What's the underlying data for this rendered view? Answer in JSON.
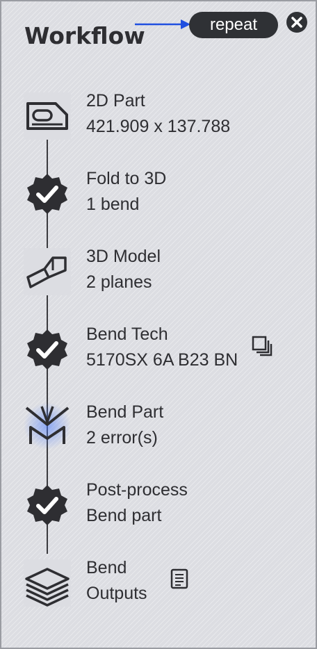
{
  "header": {
    "title": "Workflow",
    "repeat_label": "repeat"
  },
  "icons": {
    "close": "close-circle-icon",
    "arrow": "arrow-right-icon"
  },
  "colors": {
    "accent_arrow": "#1f4fe0",
    "dark": "#2f3135",
    "glow": "#4c7cff"
  },
  "steps": [
    {
      "title": "2D Part",
      "subtitle": "421.909 x 137.788",
      "icon": "flat-part-icon"
    },
    {
      "title": "Fold to 3D",
      "subtitle": "1 bend",
      "icon": "check-badge-icon"
    },
    {
      "title": "3D Model",
      "subtitle": "2 planes",
      "icon": "3d-model-icon"
    },
    {
      "title": "Bend Tech",
      "subtitle": "5170SX 6A B23 BN",
      "icon": "check-badge-icon",
      "side_icon": "copy-stack-icon"
    },
    {
      "title": "Bend Part",
      "subtitle": "2 error(s)",
      "icon": "press-brake-icon"
    },
    {
      "title": "Post-process",
      "subtitle": "Bend part",
      "icon": "check-badge-icon"
    },
    {
      "title": "Bend",
      "subtitle": "Outputs",
      "icon": "layers-icon",
      "side_icon": "report-icon"
    }
  ]
}
